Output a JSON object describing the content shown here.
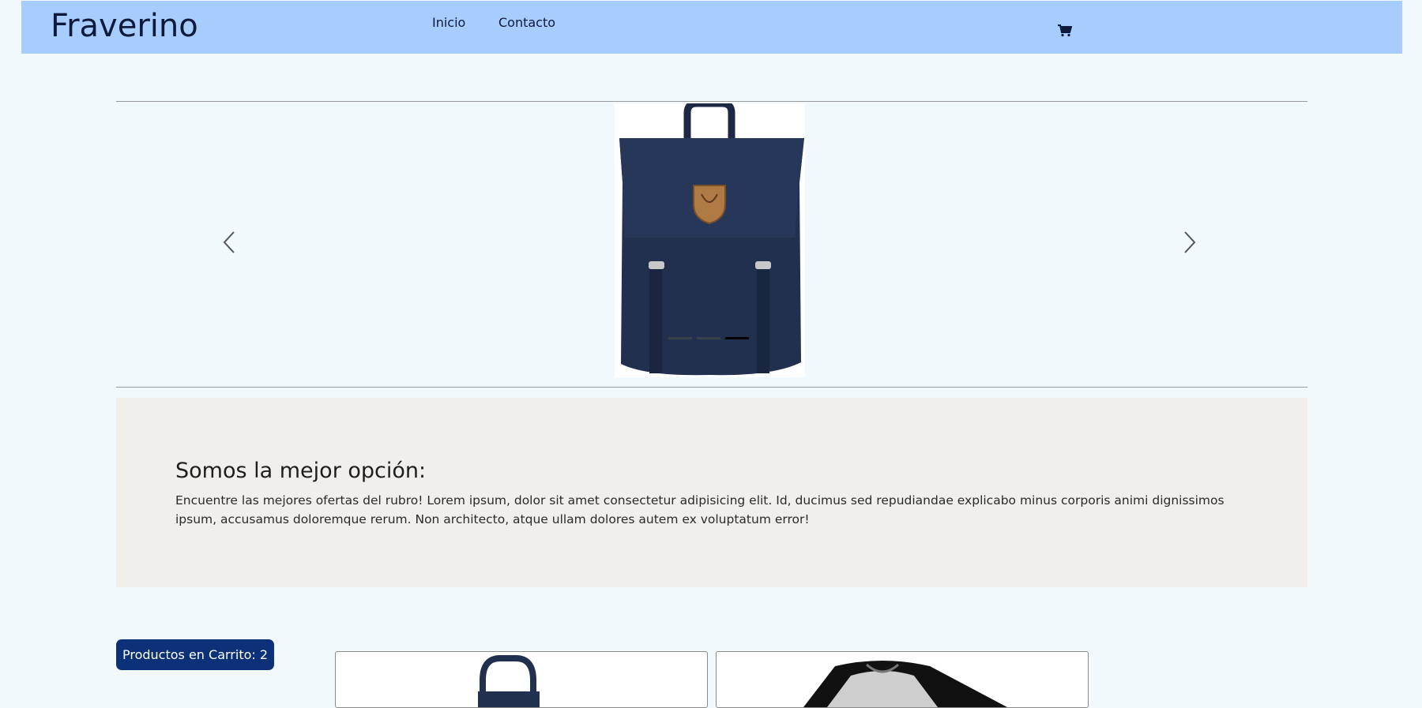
{
  "brand": "Fraverino",
  "nav": {
    "links": [
      "Inicio",
      "Contacto"
    ]
  },
  "icons": {
    "cart": "shopping-cart-icon",
    "prev": "chevron-left-icon",
    "next": "chevron-right-icon"
  },
  "carousel": {
    "slides": 3,
    "active_slide": 3
  },
  "about": {
    "title": "Somos la mejor opción:",
    "text": "Encuentre las mejores ofertas del rubro! Lorem ipsum, dolor sit amet consectetur adipisicing elit. Id, ducimus sed repudiandae explicabo minus corporis animi dignissimos ipsum, accusamus doloremque rerum. Non architecto, atque ullam dolores autem ex voluptatum error!"
  },
  "cart": {
    "label": "Productos en Carrito: 2"
  },
  "colors": {
    "navbar": "#a7ccfe",
    "page_bg": "#f1f9fd",
    "about_bg": "#f0efea",
    "badge_bg": "#0c3179",
    "backpack": "#22304f"
  }
}
